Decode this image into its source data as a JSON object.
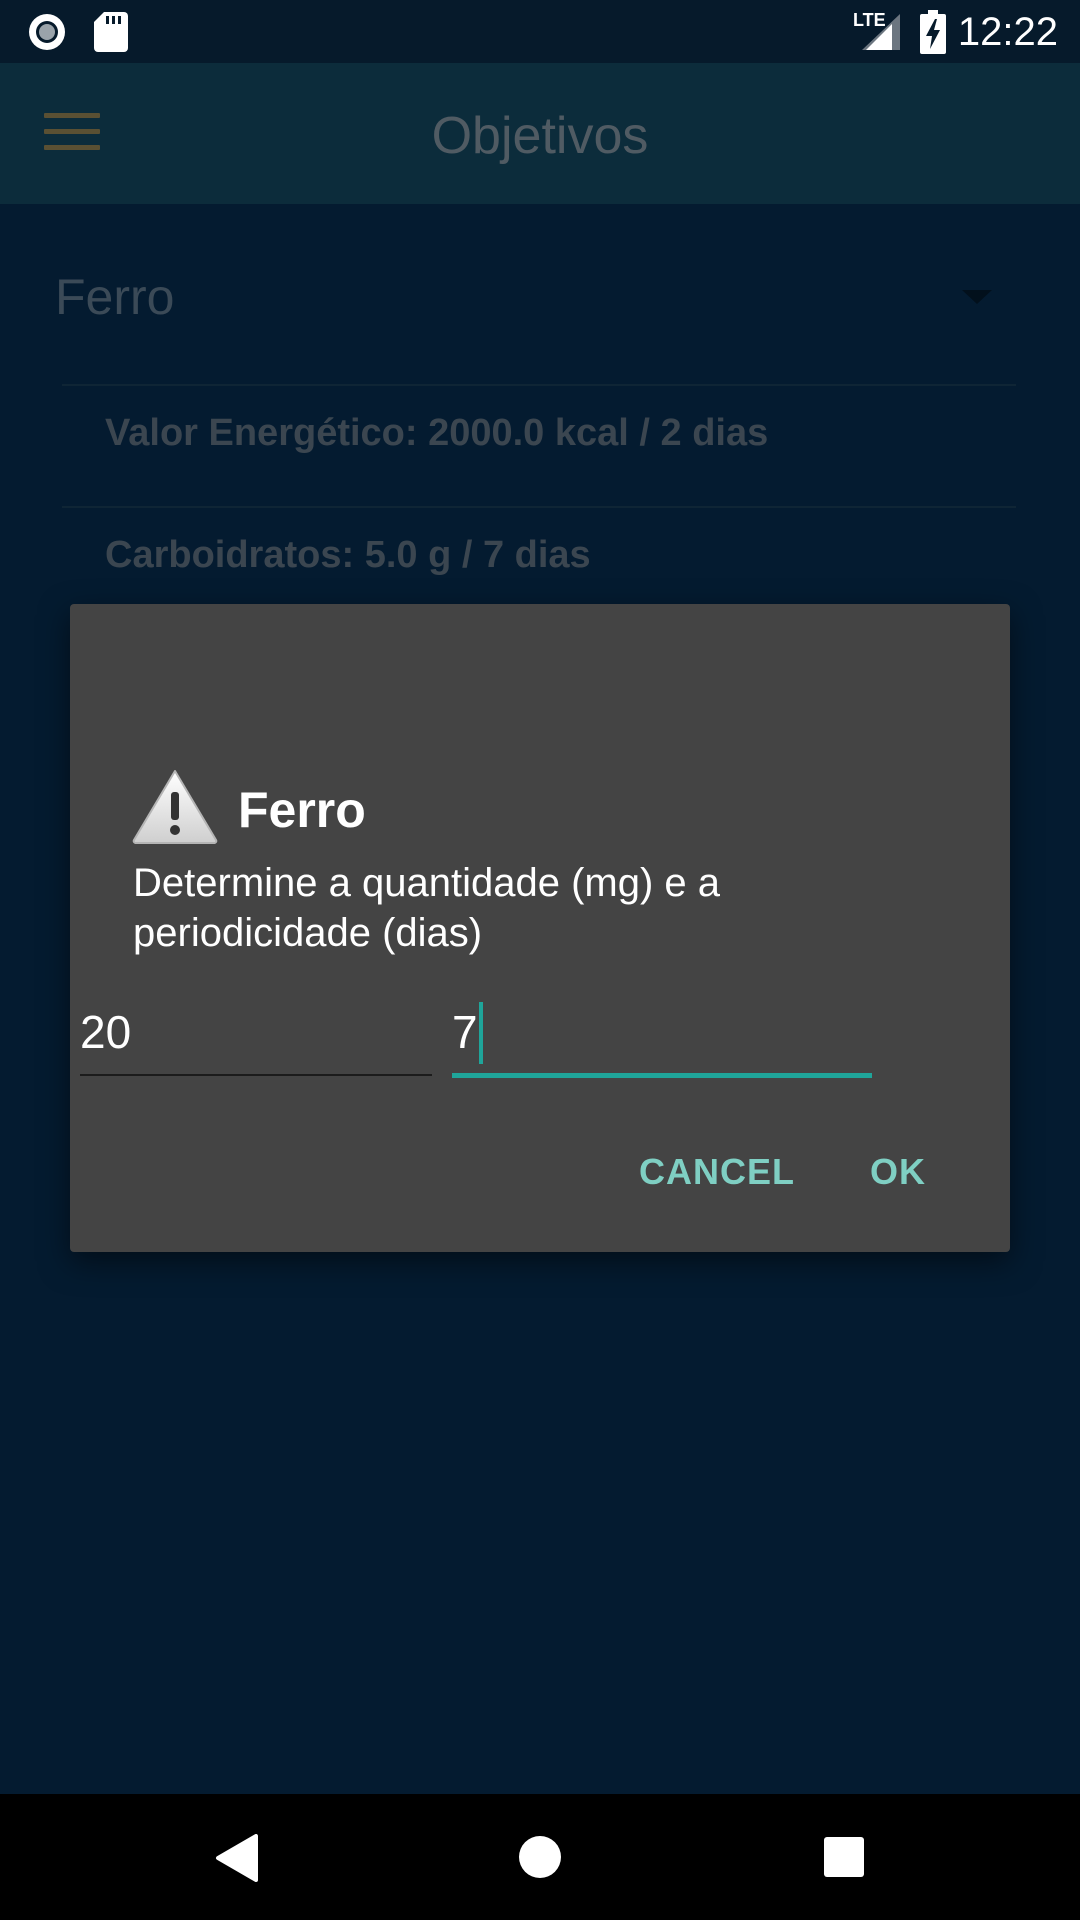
{
  "status_bar": {
    "time": "12:22",
    "network": "LTE",
    "icons": [
      "record-icon",
      "sd-card-icon",
      "signal-icon",
      "battery-charging-icon"
    ]
  },
  "toolbar": {
    "title": "Objetivos",
    "menu_icon": "hamburger-menu-icon"
  },
  "spinner": {
    "selected": "Ferro"
  },
  "goals": [
    {
      "label": "Valor Energético: 2000.0 kcal / 2 dias"
    },
    {
      "label": "Carboidratos: 5.0 g / 7 dias"
    }
  ],
  "dialog": {
    "icon": "warning-icon",
    "title": "Ferro",
    "message": "Determine a quantidade (mg) e a periodicidade (dias)",
    "quantity_value": "20",
    "period_value": "7",
    "cancel_label": "CANCEL",
    "ok_label": "OK"
  },
  "nav_bar": {
    "icons": [
      "back-icon",
      "home-icon",
      "recents-icon"
    ]
  },
  "colors": {
    "background": "#041b30",
    "toolbar": "#0c2c3b",
    "dialog": "#444444",
    "accent": "#1fa59a",
    "button_text": "#7fcfc3"
  }
}
